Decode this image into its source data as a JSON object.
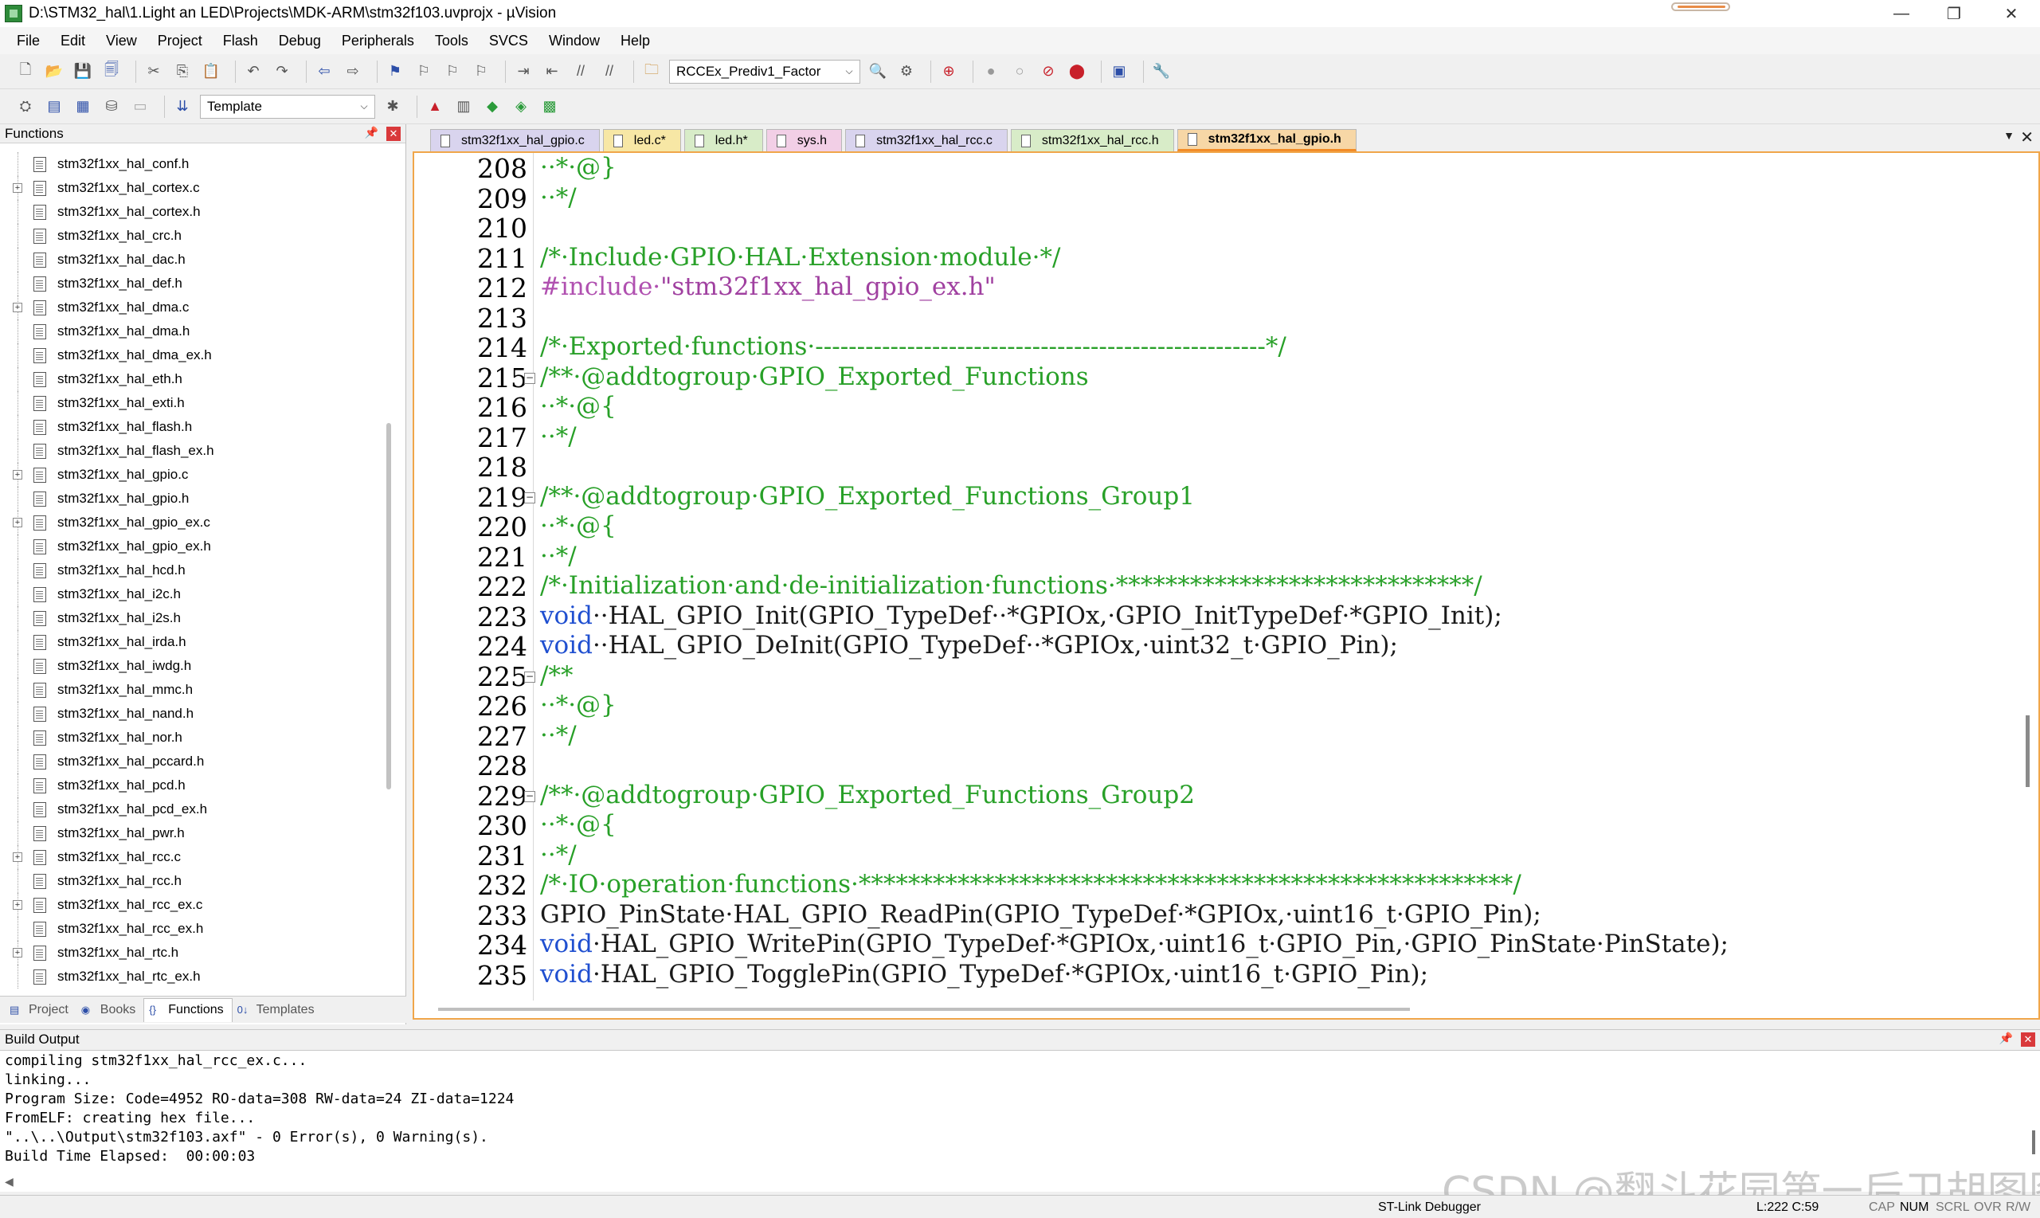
{
  "window": {
    "title": "D:\\STM32_hal\\1.Light an LED\\Projects\\MDK-ARM\\stm32f103.uvprojx - µVision",
    "minimize": "—",
    "maximize": "❐",
    "close": "✕"
  },
  "menu": [
    "File",
    "Edit",
    "View",
    "Project",
    "Flash",
    "Debug",
    "Peripherals",
    "Tools",
    "SVCS",
    "Window",
    "Help"
  ],
  "toolbar": {
    "find_combo_value": "RCCEx_Prediv1_Factor",
    "target_combo_value": "Template"
  },
  "functions_panel": {
    "title": "Functions",
    "items": [
      {
        "name": "stm32f1xx_hal_conf.h",
        "expandable": false
      },
      {
        "name": "stm32f1xx_hal_cortex.c",
        "expandable": true
      },
      {
        "name": "stm32f1xx_hal_cortex.h",
        "expandable": false
      },
      {
        "name": "stm32f1xx_hal_crc.h",
        "expandable": false
      },
      {
        "name": "stm32f1xx_hal_dac.h",
        "expandable": false
      },
      {
        "name": "stm32f1xx_hal_def.h",
        "expandable": false
      },
      {
        "name": "stm32f1xx_hal_dma.c",
        "expandable": true
      },
      {
        "name": "stm32f1xx_hal_dma.h",
        "expandable": false
      },
      {
        "name": "stm32f1xx_hal_dma_ex.h",
        "expandable": false
      },
      {
        "name": "stm32f1xx_hal_eth.h",
        "expandable": false
      },
      {
        "name": "stm32f1xx_hal_exti.h",
        "expandable": false
      },
      {
        "name": "stm32f1xx_hal_flash.h",
        "expandable": false
      },
      {
        "name": "stm32f1xx_hal_flash_ex.h",
        "expandable": false
      },
      {
        "name": "stm32f1xx_hal_gpio.c",
        "expandable": true
      },
      {
        "name": "stm32f1xx_hal_gpio.h",
        "expandable": false
      },
      {
        "name": "stm32f1xx_hal_gpio_ex.c",
        "expandable": true
      },
      {
        "name": "stm32f1xx_hal_gpio_ex.h",
        "expandable": false
      },
      {
        "name": "stm32f1xx_hal_hcd.h",
        "expandable": false
      },
      {
        "name": "stm32f1xx_hal_i2c.h",
        "expandable": false
      },
      {
        "name": "stm32f1xx_hal_i2s.h",
        "expandable": false
      },
      {
        "name": "stm32f1xx_hal_irda.h",
        "expandable": false
      },
      {
        "name": "stm32f1xx_hal_iwdg.h",
        "expandable": false
      },
      {
        "name": "stm32f1xx_hal_mmc.h",
        "expandable": false
      },
      {
        "name": "stm32f1xx_hal_nand.h",
        "expandable": false
      },
      {
        "name": "stm32f1xx_hal_nor.h",
        "expandable": false
      },
      {
        "name": "stm32f1xx_hal_pccard.h",
        "expandable": false
      },
      {
        "name": "stm32f1xx_hal_pcd.h",
        "expandable": false
      },
      {
        "name": "stm32f1xx_hal_pcd_ex.h",
        "expandable": false
      },
      {
        "name": "stm32f1xx_hal_pwr.h",
        "expandable": false
      },
      {
        "name": "stm32f1xx_hal_rcc.c",
        "expandable": true
      },
      {
        "name": "stm32f1xx_hal_rcc.h",
        "expandable": false
      },
      {
        "name": "stm32f1xx_hal_rcc_ex.c",
        "expandable": true
      },
      {
        "name": "stm32f1xx_hal_rcc_ex.h",
        "expandable": false
      },
      {
        "name": "stm32f1xx_hal_rtc.h",
        "expandable": true
      },
      {
        "name": "stm32f1xx_hal_rtc_ex.h",
        "expandable": false
      }
    ],
    "bottom_tabs": [
      {
        "label": "Project",
        "icon": "project-icon",
        "active": false
      },
      {
        "label": "Books",
        "icon": "books-icon",
        "active": false
      },
      {
        "label": "Functions",
        "icon": "functions-icon",
        "active": true
      },
      {
        "label": "Templates",
        "icon": "templates-icon",
        "active": false
      }
    ]
  },
  "editor_tabs": [
    {
      "label": "stm32f1xx_hal_gpio.c",
      "color": "#d9d4ee",
      "active": false
    },
    {
      "label": "led.c*",
      "color": "#f7e7a5",
      "active": false
    },
    {
      "label": "led.h*",
      "color": "#d8ecc8",
      "active": false
    },
    {
      "label": "sys.h",
      "color": "#f2cfe6",
      "active": false
    },
    {
      "label": "stm32f1xx_hal_rcc.c",
      "color": "#d9d4ee",
      "active": false
    },
    {
      "label": "stm32f1xx_hal_rcc.h",
      "color": "#d8ecc8",
      "active": false
    },
    {
      "label": "stm32f1xx_hal_gpio.h",
      "color": "#f7d7a6",
      "active": true
    }
  ],
  "code_lines": [
    {
      "n": "208",
      "fold": "",
      "parts": [
        {
          "c": "com",
          "t": "··*·@}"
        }
      ]
    },
    {
      "n": "209",
      "fold": "",
      "parts": [
        {
          "c": "com",
          "t": "··*/"
        }
      ]
    },
    {
      "n": "210",
      "fold": "",
      "parts": []
    },
    {
      "n": "211",
      "fold": "",
      "parts": [
        {
          "c": "com",
          "t": "/*·Include·GPIO·HAL·Extension·module·*/"
        }
      ]
    },
    {
      "n": "212",
      "fold": "",
      "parts": [
        {
          "c": "pre",
          "t": "#include·"
        },
        {
          "c": "str",
          "t": "\"stm32f1xx_hal_gpio_ex.h\""
        }
      ]
    },
    {
      "n": "213",
      "fold": "",
      "parts": []
    },
    {
      "n": "214",
      "fold": "",
      "parts": [
        {
          "c": "com",
          "t": "/*·Exported·functions·------------------------------------------------------*/"
        }
      ]
    },
    {
      "n": "215",
      "fold": "⊟",
      "parts": [
        {
          "c": "com",
          "t": "/**·@addtogroup·GPIO_Exported_Functions"
        }
      ]
    },
    {
      "n": "216",
      "fold": "",
      "parts": [
        {
          "c": "com",
          "t": "··*·@{"
        }
      ]
    },
    {
      "n": "217",
      "fold": "",
      "parts": [
        {
          "c": "com",
          "t": "··*/"
        }
      ]
    },
    {
      "n": "218",
      "fold": "",
      "parts": []
    },
    {
      "n": "219",
      "fold": "⊟",
      "parts": [
        {
          "c": "com",
          "t": "/**·@addtogroup·GPIO_Exported_Functions_Group1"
        }
      ]
    },
    {
      "n": "220",
      "fold": "",
      "parts": [
        {
          "c": "com",
          "t": "··*·@{"
        }
      ]
    },
    {
      "n": "221",
      "fold": "",
      "parts": [
        {
          "c": "com",
          "t": "··*/"
        }
      ]
    },
    {
      "n": "222",
      "fold": "",
      "parts": [
        {
          "c": "com",
          "t": "/*·Initialization·and·de-initialization·functions·*****************************/"
        }
      ]
    },
    {
      "n": "223",
      "fold": "",
      "parts": [
        {
          "c": "kw",
          "t": "void"
        },
        {
          "c": "txt",
          "t": "··HAL_GPIO_Init(GPIO_TypeDef··*GPIOx,·GPIO_InitTypeDef·*GPIO_Init);"
        }
      ]
    },
    {
      "n": "224",
      "fold": "",
      "parts": [
        {
          "c": "kw",
          "t": "void"
        },
        {
          "c": "txt",
          "t": "··HAL_GPIO_DeInit(GPIO_TypeDef··*GPIOx,·uint32_t·GPIO_Pin);"
        }
      ]
    },
    {
      "n": "225",
      "fold": "⊟",
      "parts": [
        {
          "c": "com",
          "t": "/**"
        }
      ]
    },
    {
      "n": "226",
      "fold": "",
      "parts": [
        {
          "c": "com",
          "t": "··*·@}"
        }
      ]
    },
    {
      "n": "227",
      "fold": "",
      "parts": [
        {
          "c": "com",
          "t": "··*/"
        }
      ]
    },
    {
      "n": "228",
      "fold": "",
      "parts": []
    },
    {
      "n": "229",
      "fold": "⊟",
      "parts": [
        {
          "c": "com",
          "t": "/**·@addtogroup·GPIO_Exported_Functions_Group2"
        }
      ]
    },
    {
      "n": "230",
      "fold": "",
      "parts": [
        {
          "c": "com",
          "t": "··*·@{"
        }
      ]
    },
    {
      "n": "231",
      "fold": "",
      "parts": [
        {
          "c": "com",
          "t": "··*/"
        }
      ]
    },
    {
      "n": "232",
      "fold": "",
      "parts": [
        {
          "c": "com",
          "t": "/*·IO·operation·functions·*****************************************************/"
        }
      ]
    },
    {
      "n": "233",
      "fold": "",
      "parts": [
        {
          "c": "txt",
          "t": "GPIO_PinState·HAL_GPIO_ReadPin(GPIO_TypeDef·*GPIOx,·uint16_t·GPIO_Pin);"
        }
      ]
    },
    {
      "n": "234",
      "fold": "",
      "parts": [
        {
          "c": "kw",
          "t": "void"
        },
        {
          "c": "txt",
          "t": "·HAL_GPIO_WritePin(GPIO_TypeDef·*GPIOx,·uint16_t·GPIO_Pin,·GPIO_PinState·PinState);"
        }
      ]
    },
    {
      "n": "235",
      "fold": "",
      "parts": [
        {
          "c": "kw",
          "t": "void"
        },
        {
          "c": "txt",
          "t": "·HAL_GPIO_TogglePin(GPIO_TypeDef·*GPIOx,·uint16_t·GPIO_Pin);"
        }
      ]
    }
  ],
  "build_output": {
    "title": "Build Output",
    "lines": [
      "compiling stm32f1xx_hal_rcc_ex.c...",
      "linking...",
      "Program Size: Code=4952 RO-data=308 RW-data=24 ZI-data=1224",
      "FromELF: creating hex file...",
      "\"..\\..\\Output\\stm32f103.axf\" - 0 Error(s), 0 Warning(s).",
      "Build Time Elapsed:  00:00:03"
    ]
  },
  "status": {
    "debugger": "ST-Link Debugger",
    "position": "L:222 C:59",
    "cap": "CAP",
    "num": "NUM",
    "scrl": "SCRL",
    "ovr": "OVR",
    "rw": "R/W"
  },
  "watermark": "CSDN @翻斗花园第一后卫胡图图",
  "colors": {
    "comment": "#28a028",
    "keyword": "#1f4fd0",
    "preprocessor": "#b050b0",
    "string": "#a040a0",
    "active_tab_underline": "#f28c28",
    "editor_border": "#f0a64a"
  }
}
